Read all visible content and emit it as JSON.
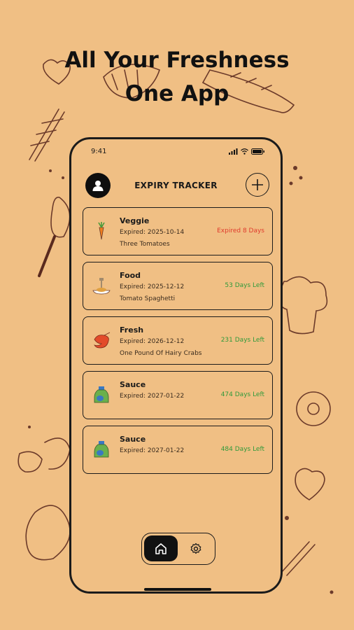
{
  "promo": {
    "line1": "All Your Freshness",
    "line2": "One App"
  },
  "status_bar": {
    "time": "9:41"
  },
  "header": {
    "title": "EXPIRY TRACKER"
  },
  "colors": {
    "background": "#f0bf84",
    "expired": "#e03a2c",
    "left": "#2f9a3a",
    "outline": "#1b1b1b"
  },
  "items": [
    {
      "name": "Veggie",
      "expired": "Expired: 2025-10-14",
      "desc": "Three Tomatoes",
      "status": "Expired 8 Days",
      "state": "expired",
      "icon": "carrot-icon"
    },
    {
      "name": "Food",
      "expired": "Expired: 2025-12-12",
      "desc": "Tomato Spaghetti",
      "status": "53 Days Left",
      "state": "left",
      "icon": "plate-icon"
    },
    {
      "name": "Fresh",
      "expired": "Expired: 2026-12-12",
      "desc": "One Pound Of Hairy Crabs",
      "status": "231 Days Left",
      "state": "left",
      "icon": "shrimp-icon"
    },
    {
      "name": "Sauce",
      "expired": "Expired: 2027-01-22",
      "desc": "",
      "status": "474 Days Left",
      "state": "left",
      "icon": "sauce-bottle-icon"
    },
    {
      "name": "Sauce",
      "expired": "Expired: 2027-01-22",
      "desc": "",
      "status": "484 Days Left",
      "state": "left",
      "icon": "sauce-bottle-icon"
    }
  ],
  "nav": {
    "home_icon": "home-icon",
    "settings_icon": "gear-icon"
  }
}
